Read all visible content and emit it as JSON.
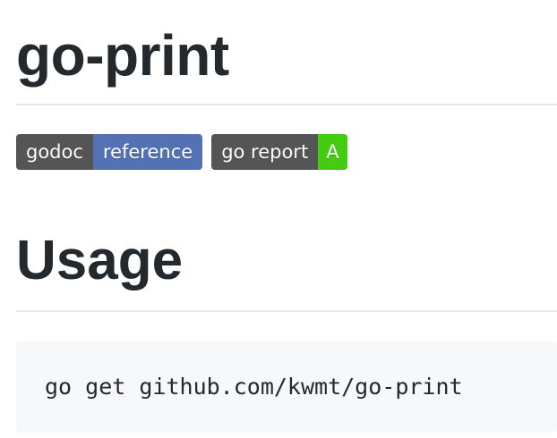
{
  "title": "go-print",
  "badges": [
    {
      "left": "godoc",
      "right": "reference",
      "right_color": "#5272b4"
    },
    {
      "left": "go report",
      "right": "A",
      "right_color": "#44cc11"
    }
  ],
  "usage": {
    "heading": "Usage",
    "code": "go get github.com/kwmt/go-print"
  }
}
